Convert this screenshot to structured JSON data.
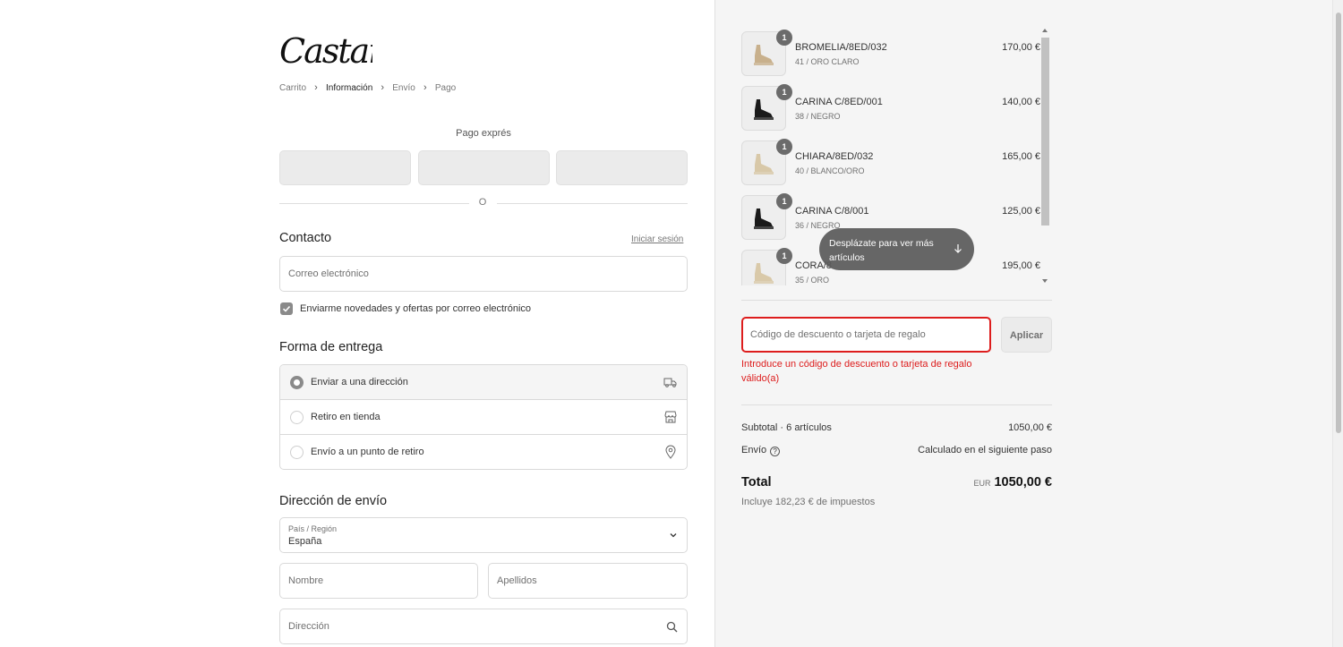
{
  "logo": {
    "text": "Castañer"
  },
  "breadcrumb": [
    {
      "label": "Carrito",
      "active": false
    },
    {
      "label": "Información",
      "active": true
    },
    {
      "label": "Envío",
      "active": false
    },
    {
      "label": "Pago",
      "active": false
    }
  ],
  "express": {
    "title": "Pago exprés",
    "divider_text": "O"
  },
  "contact": {
    "title": "Contacto",
    "login_link": "Iniciar sesión",
    "email_placeholder": "Correo electrónico",
    "newsletter_label": "Enviarme novedades y ofertas por correo electrónico",
    "newsletter_checked": true
  },
  "delivery": {
    "title": "Forma de entrega",
    "options": [
      {
        "label": "Enviar a una dirección",
        "icon": "truck-icon",
        "selected": true
      },
      {
        "label": "Retiro en tienda",
        "icon": "store-icon",
        "selected": false
      },
      {
        "label": "Envío a un punto de retiro",
        "icon": "location-pin-icon",
        "selected": false
      }
    ]
  },
  "shipping": {
    "title": "Dirección de envío",
    "country_label": "País / Región",
    "country_value": "España",
    "first_name_placeholder": "Nombre",
    "last_name_placeholder": "Apellidos",
    "address_placeholder": "Dirección"
  },
  "cart": {
    "items": [
      {
        "qty": "1",
        "name": "BROMELIA/8ED/032",
        "variant": "41 / ORO CLARO",
        "price": "170,00 €",
        "shoe_color": "#c8b08c"
      },
      {
        "qty": "1",
        "name": "CARINA C/8ED/001",
        "variant": "38 / NEGRO",
        "price": "140,00 €",
        "shoe_color": "#1a1a1a"
      },
      {
        "qty": "1",
        "name": "CHIARA/8ED/032",
        "variant": "40 / BLANCO/ORO",
        "price": "165,00 €",
        "shoe_color": "#d8c8a8"
      },
      {
        "qty": "1",
        "name": "CARINA C/8/001",
        "variant": "36 / NEGRO",
        "price": "125,00 €",
        "shoe_color": "#1a1a1a"
      },
      {
        "qty": "1",
        "name": "CORA/8",
        "variant": "35 / ORO",
        "price": "195,00 €",
        "shoe_color": "#d9c9a9"
      }
    ],
    "scroll_hint": "Desplázate para ver más artículos",
    "discount_placeholder": "Código de descuento o tarjeta de regalo",
    "apply_label": "Aplicar",
    "error_text": "Introduce un código de descuento o tarjeta de regalo válido(a)",
    "subtotal_label": "Subtotal · 6 artículos",
    "subtotal_value": "1050,00 €",
    "shipping_label": "Envío",
    "shipping_value": "Calculado en el siguiente paso",
    "total_label": "Total",
    "currency": "EUR",
    "total_value": "1050,00 €",
    "tax_note": "Incluye 182,23 € de impuestos"
  },
  "colors": {
    "error": "#dd1d1d",
    "accent_gray": "#8a8a8a"
  }
}
